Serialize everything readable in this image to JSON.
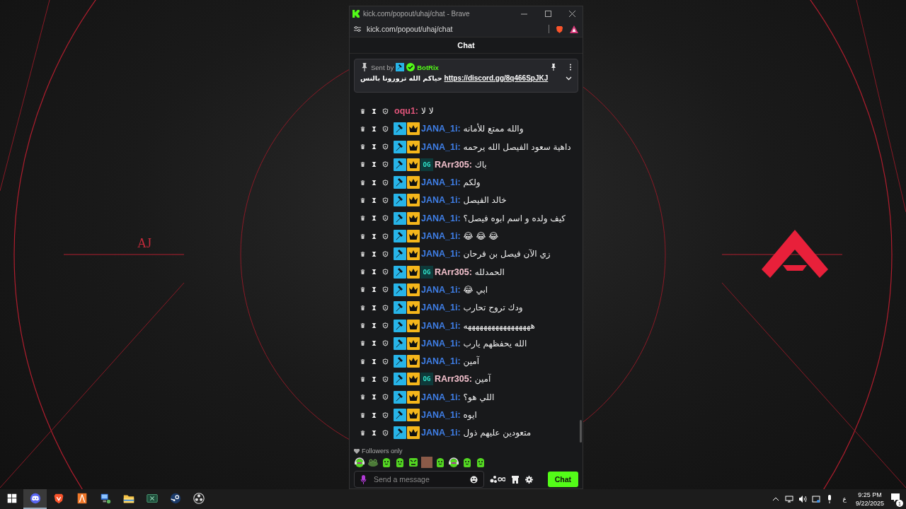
{
  "wallpaper": {
    "caption": "AJ"
  },
  "window": {
    "title": "kick.com/popout/uhaj/chat - Brave",
    "url": "kick.com/popout/uhaj/chat"
  },
  "chat": {
    "header": "Chat",
    "pinned": {
      "sent_by": "Sent by",
      "sender": "BotRix",
      "text": "حياكم الله تزورونا بالنس",
      "link": "https://discord.gg/8q466SpJKJ"
    },
    "messages": [
      {
        "user": "oqu1:",
        "color": "#e0557a",
        "text": "لا لا"
      },
      {
        "user": "JANA_1i:",
        "color": "#3f7fe8",
        "badges": [
          {
            "kind": "moderator"
          },
          {
            "kind": "crown"
          }
        ],
        "text": "والله ممتع للأمانه"
      },
      {
        "user": "JANA_1i:",
        "color": "#3f7fe8",
        "badges": [
          {
            "kind": "moderator"
          },
          {
            "kind": "crown"
          }
        ],
        "text": "داهية سعود الفيصل الله يرحمه"
      },
      {
        "user": "RArr305:",
        "color": "#f6c3cf",
        "badges": [
          {
            "kind": "moderator"
          },
          {
            "kind": "crown"
          },
          {
            "kind": "og",
            "label": "OG"
          }
        ],
        "text": "باك"
      },
      {
        "user": "JANA_1i:",
        "color": "#3f7fe8",
        "badges": [
          {
            "kind": "moderator"
          },
          {
            "kind": "crown"
          }
        ],
        "text": "ولكم"
      },
      {
        "user": "JANA_1i:",
        "color": "#3f7fe8",
        "badges": [
          {
            "kind": "moderator"
          },
          {
            "kind": "crown"
          }
        ],
        "text": "خالد الفيصل"
      },
      {
        "user": "JANA_1i:",
        "color": "#3f7fe8",
        "badges": [
          {
            "kind": "moderator"
          },
          {
            "kind": "crown"
          }
        ],
        "text": "كيف ولده و اسم ابوه فيصل؟"
      },
      {
        "user": "JANA_1i:",
        "color": "#3f7fe8",
        "badges": [
          {
            "kind": "moderator"
          },
          {
            "kind": "crown"
          }
        ],
        "text": "😂 😂 😂"
      },
      {
        "user": "JANA_1i:",
        "color": "#3f7fe8",
        "badges": [
          {
            "kind": "moderator"
          },
          {
            "kind": "crown"
          }
        ],
        "text": "زي الآن فيصل بن فرحان"
      },
      {
        "user": "RArr305:",
        "color": "#f6c3cf",
        "badges": [
          {
            "kind": "moderator"
          },
          {
            "kind": "crown"
          },
          {
            "kind": "og",
            "label": "OG"
          }
        ],
        "text": "الحمدلله"
      },
      {
        "user": "JANA_1i:",
        "color": "#3f7fe8",
        "badges": [
          {
            "kind": "moderator"
          },
          {
            "kind": "crown"
          }
        ],
        "text": "ابي 😂"
      },
      {
        "user": "JANA_1i:",
        "color": "#3f7fe8",
        "badges": [
          {
            "kind": "moderator"
          },
          {
            "kind": "crown"
          }
        ],
        "text": "ودك تروح تحارب"
      },
      {
        "user": "JANA_1i:",
        "color": "#3f7fe8",
        "badges": [
          {
            "kind": "moderator"
          },
          {
            "kind": "crown"
          }
        ],
        "text": "هههههههههههههههههه"
      },
      {
        "user": "JANA_1i:",
        "color": "#3f7fe8",
        "badges": [
          {
            "kind": "moderator"
          },
          {
            "kind": "crown"
          }
        ],
        "text": "الله يحفظهم يارب"
      },
      {
        "user": "JANA_1i:",
        "color": "#3f7fe8",
        "badges": [
          {
            "kind": "moderator"
          },
          {
            "kind": "crown"
          }
        ],
        "text": "آمين"
      },
      {
        "user": "RArr305:",
        "color": "#f6c3cf",
        "badges": [
          {
            "kind": "moderator"
          },
          {
            "kind": "crown"
          },
          {
            "kind": "og",
            "label": "OG"
          }
        ],
        "text": "آمين"
      },
      {
        "user": "JANA_1i:",
        "color": "#3f7fe8",
        "badges": [
          {
            "kind": "moderator"
          },
          {
            "kind": "crown"
          }
        ],
        "text": "اللي هو؟"
      },
      {
        "user": "JANA_1i:",
        "color": "#3f7fe8",
        "badges": [
          {
            "kind": "moderator"
          },
          {
            "kind": "crown"
          }
        ],
        "text": "ايوه"
      },
      {
        "user": "JANA_1i:",
        "color": "#3f7fe8",
        "badges": [
          {
            "kind": "moderator"
          },
          {
            "kind": "crown"
          }
        ],
        "text": "متعودين عليهم ذول"
      }
    ],
    "mode": "Followers only",
    "emotes": [
      {
        "kind": "headset"
      },
      {
        "kind": "frog"
      },
      {
        "kind": "blob"
      },
      {
        "kind": "blob"
      },
      {
        "kind": "angry"
      },
      {
        "kind": "photo"
      },
      {
        "kind": "blob"
      },
      {
        "kind": "headset"
      },
      {
        "kind": "blob"
      },
      {
        "kind": "blob"
      }
    ],
    "input": {
      "placeholder": "Send a message"
    },
    "send_button": "Chat"
  },
  "taskbar": {
    "apps": [
      {
        "kind": "start",
        "selected": false
      },
      {
        "kind": "discord",
        "selected": true
      },
      {
        "kind": "brave",
        "selected": false
      },
      {
        "kind": "orange",
        "selected": false
      },
      {
        "kind": "network",
        "selected": false
      },
      {
        "kind": "folder",
        "selected": false
      },
      {
        "kind": "sheet",
        "selected": false
      },
      {
        "kind": "steam",
        "selected": false
      },
      {
        "kind": "obs",
        "selected": false
      }
    ],
    "language": "ع",
    "time": "9:25 PM",
    "date": "9/22/2025",
    "notifications": "1"
  }
}
